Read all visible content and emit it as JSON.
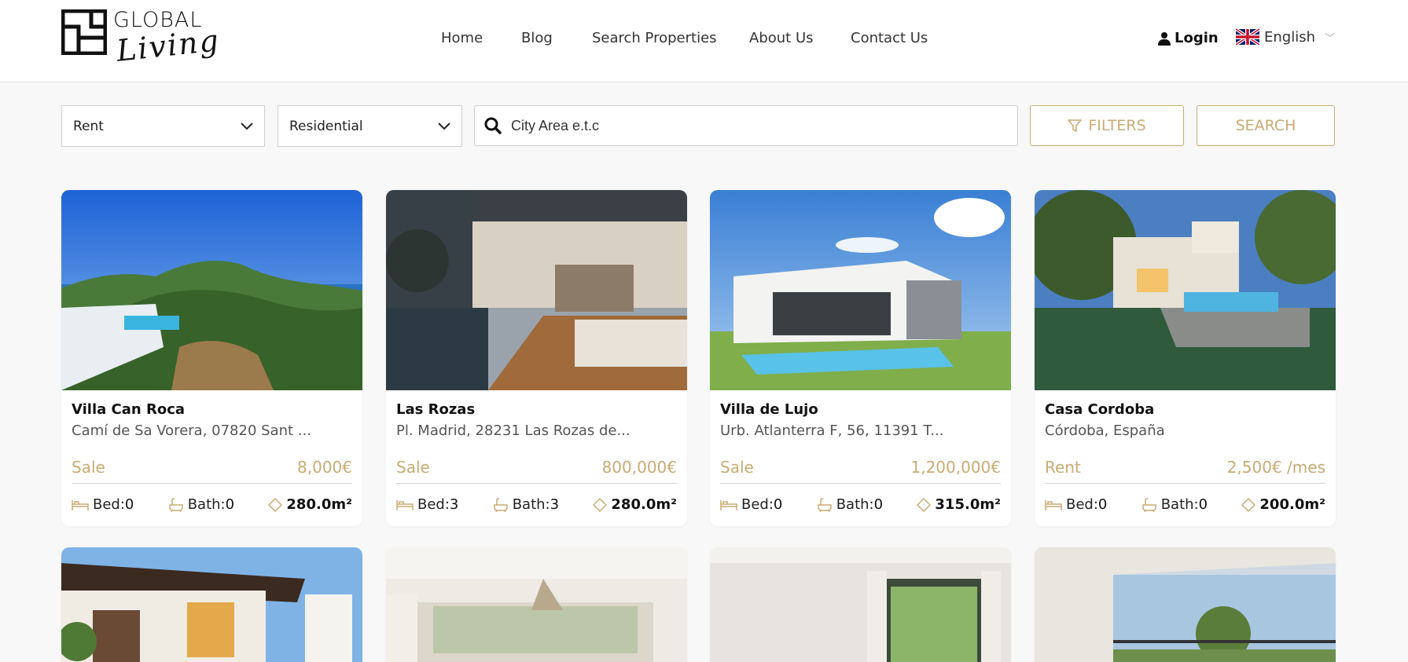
{
  "brand": {
    "name_top": "GLOBAL",
    "name_bottom": "Living"
  },
  "nav": {
    "items": [
      "Home",
      "Blog",
      "Search Properties",
      "About Us",
      "Contact Us"
    ]
  },
  "account": {
    "login_label": "Login"
  },
  "language": {
    "selected": "English"
  },
  "search": {
    "type": "Rent",
    "category": "Residential",
    "placeholder": "City Area e.t.c",
    "filters_label": "FILTERS",
    "search_label": "SEARCH"
  },
  "colors": {
    "accent": "#c9ab73",
    "background": "#f8f8f8"
  },
  "listings": [
    {
      "title": "Villa Can Roca",
      "address": "Camí de Sa Vorera, 07820 Sant ...",
      "status": "Sale",
      "price": "8,000€",
      "bed_label": "Bed:",
      "bed": "0",
      "bath_label": "Bath:",
      "bath": "0",
      "area": "280.0m²"
    },
    {
      "title": "Las Rozas",
      "address": "Pl. Madrid, 28231 Las Rozas de...",
      "status": "Sale",
      "price": "800,000€",
      "bed_label": "Bed:",
      "bed": "3",
      "bath_label": "Bath:",
      "bath": "3",
      "area": "280.0m²"
    },
    {
      "title": "Villa de Lujo",
      "address": "Urb. Atlanterra F, 56, 11391 T...",
      "status": "Sale",
      "price": "1,200,000€",
      "bed_label": "Bed:",
      "bed": "0",
      "bath_label": "Bath:",
      "bath": "0",
      "area": "315.0m²"
    },
    {
      "title": "Casa Cordoba",
      "address": "Córdoba, España",
      "status": "Rent",
      "price": "2,500€ /mes",
      "bed_label": "Bed:",
      "bed": "0",
      "bath_label": "Bath:",
      "bath": "0",
      "area": "200.0m²"
    }
  ],
  "icons": {
    "user": "user-icon",
    "flag": "uk-flag-icon",
    "search": "search-icon",
    "filter": "filter-icon",
    "bed": "bed-icon",
    "bath": "bathtub-icon",
    "area": "area-icon"
  }
}
